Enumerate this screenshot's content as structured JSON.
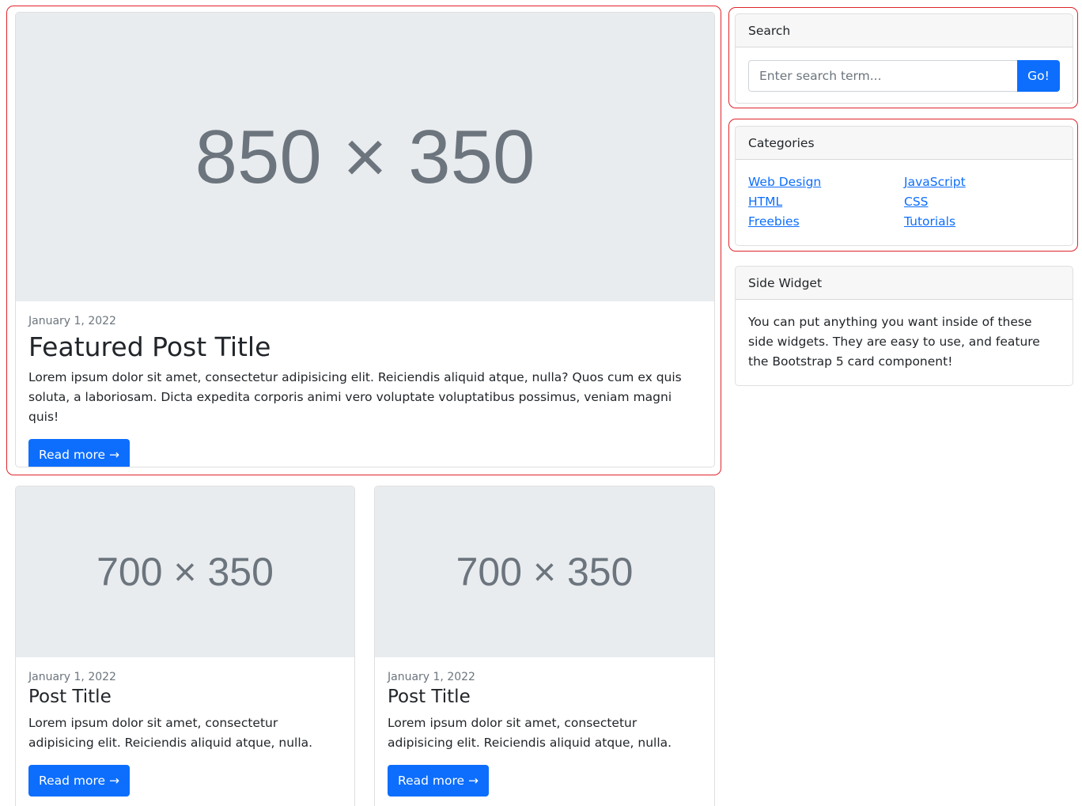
{
  "featured": {
    "image_text": "850 × 350",
    "date": "January 1, 2022",
    "title": "Featured Post Title",
    "text": "Lorem ipsum dolor sit amet, consectetur adipisicing elit. Reiciendis aliquid atque, nulla? Quos cum ex quis soluta, a laboriosam. Dicta expedita corporis animi vero voluptate voluptatibus possimus, veniam magni quis!",
    "button": "Read more →"
  },
  "posts": [
    {
      "image_text": "700 × 350",
      "date": "January 1, 2022",
      "title": "Post Title",
      "text": "Lorem ipsum dolor sit amet, consectetur adipisicing elit. Reiciendis aliquid atque, nulla.",
      "button": "Read more →"
    },
    {
      "image_text": "700 × 350",
      "date": "January 1, 2022",
      "title": "Post Title",
      "text": "Lorem ipsum dolor sit amet, consectetur adipisicing elit. Reiciendis aliquid atque, nulla.",
      "button": "Read more →"
    }
  ],
  "search": {
    "header": "Search",
    "placeholder": "Enter search term...",
    "button": "Go!"
  },
  "categories": {
    "header": "Categories",
    "left": [
      "Web Design",
      "HTML",
      "Freebies"
    ],
    "right": [
      "JavaScript",
      "CSS",
      "Tutorials"
    ]
  },
  "side_widget": {
    "header": "Side Widget",
    "text": "You can put anything you want inside of these side widgets. They are easy to use, and feature the Bootstrap 5 card component!"
  },
  "colors": {
    "primary": "#0d6efd",
    "highlight": "#e0242b",
    "placeholder_bg": "#e9ecef"
  }
}
